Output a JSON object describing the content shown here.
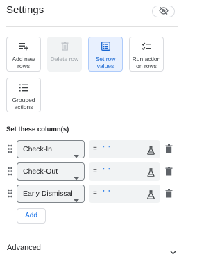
{
  "header": {
    "title": "Settings",
    "visibility_icon": "visibility-off-icon"
  },
  "actions": [
    {
      "label": "Add new rows",
      "icon": "add-list-icon",
      "state": "default"
    },
    {
      "label": "Delete row",
      "icon": "trash-icon",
      "state": "disabled"
    },
    {
      "label": "Set row values",
      "icon": "form-icon",
      "state": "selected"
    },
    {
      "label": "Run action on rows",
      "icon": "checklist-icon",
      "state": "default"
    },
    {
      "label": "Grouped actions",
      "icon": "list-icon",
      "state": "default"
    }
  ],
  "columns_section": {
    "label": "Set these column(s)",
    "rows": [
      {
        "column": "Check-In",
        "operator": "=",
        "value": "\" \""
      },
      {
        "column": "Check-Out",
        "operator": "=",
        "value": "\" \""
      },
      {
        "column": "Early Dismissal",
        "operator": "=",
        "value": "\" \""
      }
    ],
    "add_label": "Add"
  },
  "advanced": {
    "label": "Advanced"
  },
  "colors": {
    "accent": "#1a73e8",
    "selected_bg": "#e8f0fe",
    "field_bg": "#f1f3f4"
  }
}
